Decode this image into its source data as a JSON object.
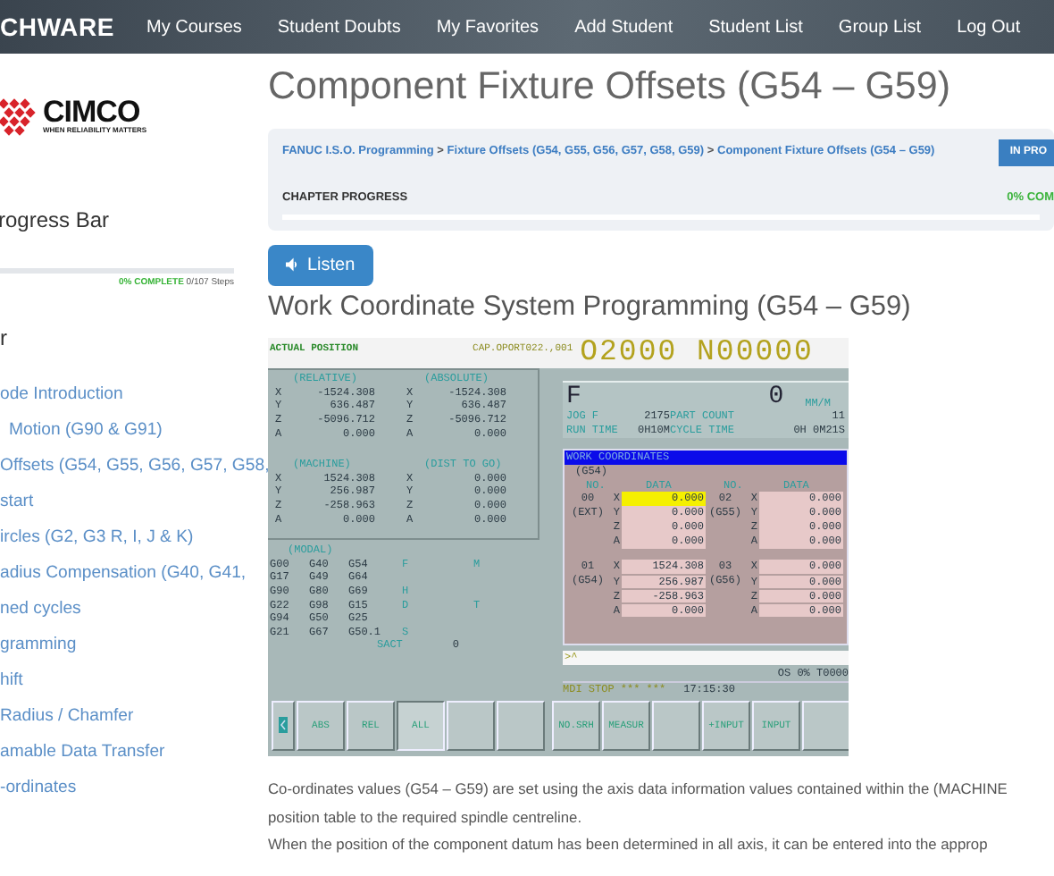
{
  "navbar": {
    "brand": "CHWARE",
    "items": [
      "My Courses",
      "Student Doubts",
      "My Favorites",
      "Add Student",
      "Student List",
      "Group List",
      "Log Out"
    ]
  },
  "sidebar": {
    "logo": {
      "name": "CIMCO",
      "tagline": "WHEN RELIABILITY MATTERS"
    },
    "progress_title": "rogress Bar",
    "progress": {
      "level": 0,
      "percent": "0% COMPLETE",
      "steps": "0/107 Steps"
    },
    "section_title": "r",
    "items": [
      {
        "text": "ode Introduction"
      },
      {
        "text": "Motion (G90 & G91)"
      },
      {
        "text": "Offsets (G54, G55, G56, G57, G58,"
      },
      {
        "text": "start"
      },
      {
        "text": "ircles (G2, G3 R, I, J & K)"
      },
      {
        "text": "adius Compensation (G40, G41,"
      },
      {
        "text": "ned cycles"
      },
      {
        "text": "gramming"
      },
      {
        "text": "hift"
      },
      {
        "text": "Radius / Chamfer"
      },
      {
        "text": "amable Data Transfer"
      },
      {
        "text": "-ordinates"
      }
    ]
  },
  "page": {
    "title": "Component Fixture Offsets (G54 – G59)",
    "breadcrumb": [
      {
        "kind": "link",
        "text": "FANUC I.S.O. Programming"
      },
      {
        "kind": "separator",
        "text": ">"
      },
      {
        "kind": "link",
        "text": "Fixture Offsets (G54, G55, G56, G57, G58, G59)"
      },
      {
        "kind": "separator",
        "text": ">"
      },
      {
        "kind": "link",
        "text": "Component Fixture Offsets (G54 – G59)"
      }
    ],
    "status_badge": "IN PRO",
    "chapter_progress": {
      "label": "CHAPTER PROGRESS",
      "reading": "0% COM",
      "level": 0
    },
    "listen_button": "Listen",
    "subtitle": "Work Coordinate System Programming (G54 – G59)",
    "cnc_screen": {
      "mode_title": "ACTUAL POSITION",
      "file": "CAP.OPORT022.,001",
      "program": "O2000 N00000",
      "positions": [
        {
          "title": "(RELATIVE)",
          "rows": [
            {
              "axis": "X",
              "value": "-1524.308"
            },
            {
              "axis": "Y",
              "value": "636.487"
            },
            {
              "axis": "Z",
              "value": "-5096.712"
            },
            {
              "axis": "A",
              "value": "0.000"
            }
          ]
        },
        {
          "title": "(ABSOLUTE)",
          "rows": [
            {
              "axis": "X",
              "value": "-1524.308"
            },
            {
              "axis": "Y",
              "value": "636.487"
            },
            {
              "axis": "Z",
              "value": "-5096.712"
            },
            {
              "axis": "A",
              "value": "0.000"
            }
          ]
        },
        {
          "title": "(MACHINE)",
          "rows": [
            {
              "axis": "X",
              "value": "1524.308"
            },
            {
              "axis": "Y",
              "value": "256.987"
            },
            {
              "axis": "Z",
              "value": "-258.963"
            },
            {
              "axis": "A",
              "value": "0.000"
            }
          ]
        },
        {
          "title": "(DIST TO GO)",
          "rows": [
            {
              "axis": "X",
              "value": "0.000"
            },
            {
              "axis": "Y",
              "value": "0.000"
            },
            {
              "axis": "Z",
              "value": "0.000"
            },
            {
              "axis": "A",
              "value": "0.000"
            }
          ]
        }
      ],
      "modal": {
        "title": "(MODAL)",
        "rows": [
          {
            "codes": [
              "G00",
              "G40",
              "G54"
            ],
            "letter": "F",
            "right": "M"
          },
          {
            "codes": [
              "G17",
              "G49",
              "G64"
            ]
          },
          {
            "codes": [
              "G90",
              "G80",
              "G69"
            ],
            "letter": "H"
          },
          {
            "codes": [
              "G22",
              "G98",
              "G15"
            ],
            "letter": "D",
            "right": "T"
          },
          {
            "codes": [
              "G94",
              "G50",
              "G25"
            ]
          },
          {
            "codes": [
              "G21",
              "G67",
              "G50.1"
            ],
            "letter": "S"
          }
        ],
        "sact_label": "SACT",
        "sact_value": "0"
      },
      "feed": {
        "label": "F",
        "value": "0",
        "unit": "MM/M",
        "rows": [
          [
            "JOG F",
            "2175",
            "PART COUNT",
            "11"
          ],
          [
            "RUN TIME",
            "0H10M",
            "CYCLE TIME",
            "0H 0M21S"
          ]
        ]
      },
      "work_coordinates": {
        "title": "WORK COORDINATES",
        "group": "(G54)",
        "headers": [
          "NO.",
          "DATA",
          "NO.",
          "DATA"
        ],
        "entries": [
          {
            "no": "00",
            "name": "(EXT)",
            "values": [
              {
                "axis": "X",
                "value": "0.000",
                "selected": true
              },
              {
                "axis": "Y",
                "value": "0.000",
                "selected": false
              },
              {
                "axis": "Z",
                "value": "0.000",
                "selected": false
              },
              {
                "axis": "A",
                "value": "0.000",
                "selected": false
              }
            ]
          },
          {
            "no": "02",
            "name": "(G55)",
            "values": [
              {
                "axis": "X",
                "value": "0.000",
                "selected": false
              },
              {
                "axis": "Y",
                "value": "0.000",
                "selected": false
              },
              {
                "axis": "Z",
                "value": "0.000",
                "selected": false
              },
              {
                "axis": "A",
                "value": "0.000",
                "selected": false
              }
            ]
          },
          {
            "no": "01",
            "name": "(G54)",
            "values": [
              {
                "axis": "X",
                "value": "1524.308",
                "selected": false
              },
              {
                "axis": "Y",
                "value": "256.987",
                "selected": false
              },
              {
                "axis": "Z",
                "value": "-258.963",
                "selected": false
              },
              {
                "axis": "A",
                "value": "0.000",
                "selected": false
              }
            ]
          },
          {
            "no": "03",
            "name": "(G56)",
            "values": [
              {
                "axis": "X",
                "value": "0.000",
                "selected": false
              },
              {
                "axis": "Y",
                "value": "0.000",
                "selected": false
              },
              {
                "axis": "Z",
                "value": "0.000",
                "selected": false
              },
              {
                "axis": "A",
                "value": "0.000",
                "selected": false
              }
            ]
          }
        ]
      },
      "input_line": ">^",
      "status_line": "OS   0% T0000",
      "run_state": "MDI STOP *** ***",
      "clock": "17:15:30",
      "softkeys": [
        {
          "kind": "arrow",
          "selected": false
        },
        {
          "kind": "label",
          "label": "ABS",
          "selected": false
        },
        {
          "kind": "label",
          "label": "REL",
          "selected": false
        },
        {
          "kind": "label",
          "label": "ALL",
          "selected": true
        },
        {
          "kind": "blank",
          "selected": false
        },
        {
          "kind": "blank",
          "selected": false
        },
        {
          "kind": "label",
          "label": "NO.SRH",
          "selected": false
        },
        {
          "kind": "label",
          "label": "MEASUR",
          "selected": false
        },
        {
          "kind": "blank",
          "selected": false
        },
        {
          "kind": "label",
          "label": "+INPUT",
          "selected": false
        },
        {
          "kind": "label",
          "label": "INPUT",
          "selected": false
        },
        {
          "kind": "blank",
          "selected": false
        }
      ]
    },
    "paragraphs": [
      {
        "lines": [
          "Co-ordinates values (G54 – G59) are set using the axis data information values contained within the (MACHINE",
          "position table to the required spindle centreline."
        ]
      },
      {
        "lines": [
          "When the position of the component datum has been determined in all axis, it can be entered into the approp"
        ]
      }
    ]
  }
}
